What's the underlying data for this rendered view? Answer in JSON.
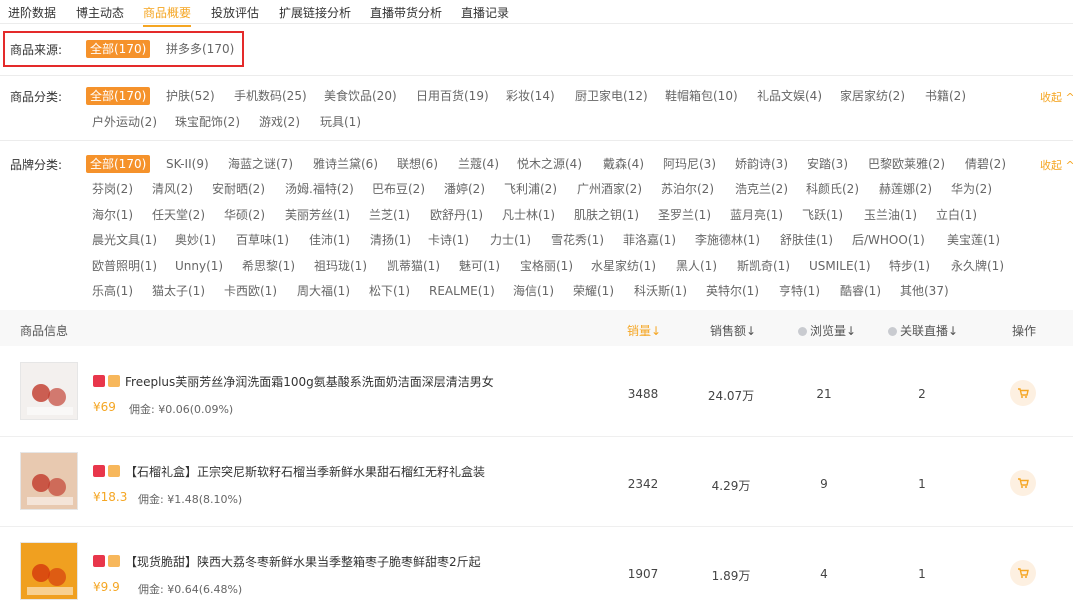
{
  "tabs": [
    "进阶数据",
    "博主动态",
    "商品概要",
    "投放评估",
    "扩展链接分析",
    "直播带货分析",
    "直播记录"
  ],
  "source": {
    "label": "商品来源:",
    "options": [
      "全部(170)",
      "拼多多(170)"
    ]
  },
  "category": {
    "label": "商品分类:",
    "collapse": "收起 ^",
    "options": [
      "全部(170)",
      "护肤(52)",
      "手机数码(25)",
      "美食饮品(20)",
      "日用百货(19)",
      "彩妆(14)",
      "厨卫家电(12)",
      "鞋帽箱包(10)",
      "礼品文娱(4)",
      "家居家纺(2)",
      "书籍(2)",
      "户外运动(2)",
      "珠宝配饰(2)",
      "游戏(2)",
      "玩具(1)"
    ]
  },
  "brand": {
    "label": "品牌分类:",
    "collapse": "收起 ^",
    "rows": [
      [
        "全部(170)",
        "SK-II(9)",
        "海蓝之谜(7)",
        "雅诗兰黛(6)",
        "联想(6)",
        "兰蔻(4)",
        "悦木之源(4)",
        "戴森(4)",
        "阿玛尼(3)",
        "娇韵诗(3)",
        "安踏(3)",
        "巴黎欧莱雅(2)",
        "倩碧(2)"
      ],
      [
        "芬岗(2)",
        "清风(2)",
        "安耐晒(2)",
        "汤姆.福特(2)",
        "巴布豆(2)",
        "潘婷(2)",
        "飞利浦(2)",
        "广州酒家(2)",
        "苏泊尔(2)",
        "浩克兰(2)",
        "科颜氏(2)",
        "赫莲娜(2)",
        "华为(2)"
      ],
      [
        "海尔(1)",
        "任天堂(2)",
        "华硕(2)",
        "芙丽芳丝(1)",
        "兰芝(1)",
        "欧舒丹(1)",
        "凡士林(1)",
        "肌肤之钥(1)",
        "圣罗兰(1)",
        "蓝月亮(1)",
        "飞跃(1)",
        "玉兰油(1)",
        "立白(1)"
      ],
      [
        "晨光文具(1)",
        "奥妙(1)",
        "百草味(1)",
        "佳沛(1)",
        "清扬(1)",
        "卡诗(1)",
        "力士(1)",
        "雪花秀(1)",
        "菲洛嘉(1)",
        "李施德林(1)",
        "舒肤佳(1)",
        "后/WHOO(1)",
        "美宝莲(1)"
      ],
      [
        "欧普照明(1)",
        "Unny(1)",
        "希思黎(1)",
        "祖玛珑(1)",
        "凯蒂猫(1)",
        "魅可(1)",
        "宝格丽(1)",
        "水星家纺(1)",
        "黑人(1)",
        "斯凯奇(1)",
        "USMILE(1)",
        "特步(1)",
        "永久牌(1)"
      ],
      [
        "乐高(1)",
        "猫太子(1)",
        "卡西欧(1)",
        "周大福(1)",
        "松下(1)",
        "REALME(1)",
        "海信(1)",
        "荣耀(1)",
        "科沃斯(1)",
        "英特尔(1)",
        "亨特(1)",
        "酷睿(1)",
        "其他(37)"
      ]
    ]
  },
  "table": {
    "headers": {
      "info": "商品信息",
      "sales": "销量↓",
      "amount": "销售额↓",
      "views": "浏览量↓",
      "live": "关联直播↓",
      "action": "操作"
    },
    "rows": [
      {
        "title": "Freeplus芙丽芳丝净润洗面霜100g氨基酸系洗面奶洁面深层清洁男女",
        "price": "¥69",
        "commission": "佣金: ¥0.06(0.09%)",
        "sales": "3488",
        "amount": "24.07万",
        "views": "21",
        "live": "2",
        "thumb_bg": "#f3f0ee",
        "thumb_fg": "#c0392b"
      },
      {
        "title": "【石榴礼盒】正宗突尼斯软籽石榴当季新鲜水果甜石榴红无籽礼盒装",
        "price": "¥18.3",
        "commission": "佣金: ¥1.48(8.10%)",
        "sales": "2342",
        "amount": "4.29万",
        "views": "9",
        "live": "1",
        "thumb_bg": "#e8c9b0",
        "thumb_fg": "#c0392b"
      },
      {
        "title": "【现货脆甜】陕西大荔冬枣新鲜水果当季整箱枣子脆枣鲜甜枣2斤起",
        "price": "¥9.9",
        "commission": "佣金: ¥0.64(6.48%)",
        "sales": "1907",
        "amount": "1.89万",
        "views": "4",
        "live": "1",
        "thumb_bg": "#f0a020",
        "thumb_fg": "#d4380d"
      }
    ]
  },
  "colors": {
    "accent": "#f5a623",
    "highlight_box": "#e42a2a"
  }
}
